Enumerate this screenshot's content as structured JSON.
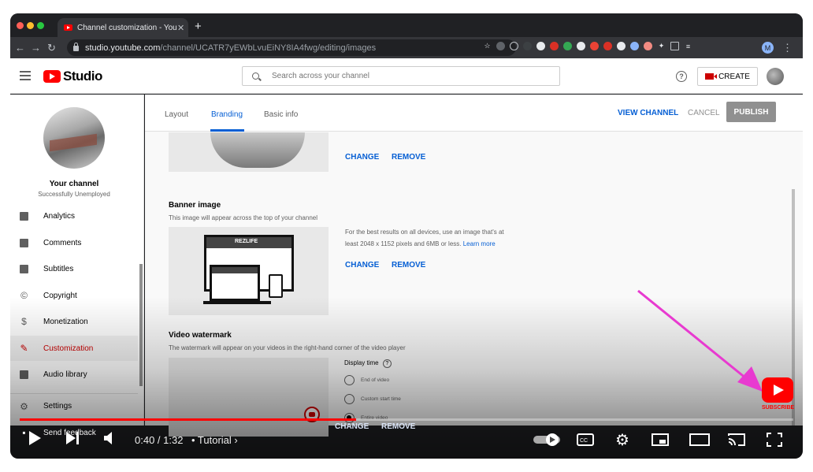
{
  "browser": {
    "tab_title": "Channel customization - YouTu",
    "tab_close": "✕",
    "new_tab": "+",
    "url_host": "studio.youtube.com",
    "url_path": "/channel/UCATR7yEWbLvuEiNY8IA4fwg/editing/images",
    "profile_initial": "M"
  },
  "header": {
    "logo_text": "Studio",
    "search_placeholder": "Search across your channel",
    "help": "?",
    "create_label": "CREATE"
  },
  "sidebar": {
    "channel_title": "Your channel",
    "channel_name": "Successfully Unemployed",
    "items": [
      {
        "label": "Analytics",
        "icon": "analytics-icon"
      },
      {
        "label": "Comments",
        "icon": "comments-icon"
      },
      {
        "label": "Subtitles",
        "icon": "subtitles-icon"
      },
      {
        "label": "Copyright",
        "icon": "copyright-icon"
      },
      {
        "label": "Monetization",
        "icon": "monetization-icon"
      },
      {
        "label": "Customization",
        "icon": "customization-icon"
      },
      {
        "label": "Audio library",
        "icon": "audio-library-icon"
      },
      {
        "label": "Settings",
        "icon": "gear-icon"
      },
      {
        "label": "Send feedback",
        "icon": "feedback-icon"
      }
    ],
    "active_item": "Customization"
  },
  "main": {
    "tabs": [
      {
        "label": "Layout"
      },
      {
        "label": "Branding"
      },
      {
        "label": "Basic info"
      }
    ],
    "active_tab": "Branding",
    "view_channel": "VIEW CHANNEL",
    "cancel": "CANCEL",
    "publish": "PUBLISH",
    "picture": {
      "change": "CHANGE",
      "remove": "REMOVE"
    },
    "banner": {
      "title": "Banner image",
      "description": "This image will appear across the top of your channel",
      "help_line1": "For the best results on all devices, use an image that's at",
      "help_line2": "least 2048 x 1152 pixels and 6MB or less.",
      "learn_more": "Learn more",
      "change": "CHANGE",
      "remove": "REMOVE",
      "art_label": "REZLIFE"
    },
    "watermark": {
      "title": "Video watermark",
      "description": "The watermark will appear on your videos in the right-hand corner of the video player",
      "display_time": "Display time",
      "options": [
        "End of video",
        "Custom start time",
        "Entire video"
      ],
      "selected": "Entire video",
      "change": "CHANGE",
      "remove": "REMOVE"
    }
  },
  "player": {
    "time": "0:40 / 1:32",
    "chapter": "• Tutorial",
    "progress": 0.435,
    "subscribe": "SUBSCRIBE"
  },
  "colors": {
    "accent_blue": "#065fd4",
    "youtube_red": "#ff0000",
    "annotation_pink": "#e83ad0"
  }
}
